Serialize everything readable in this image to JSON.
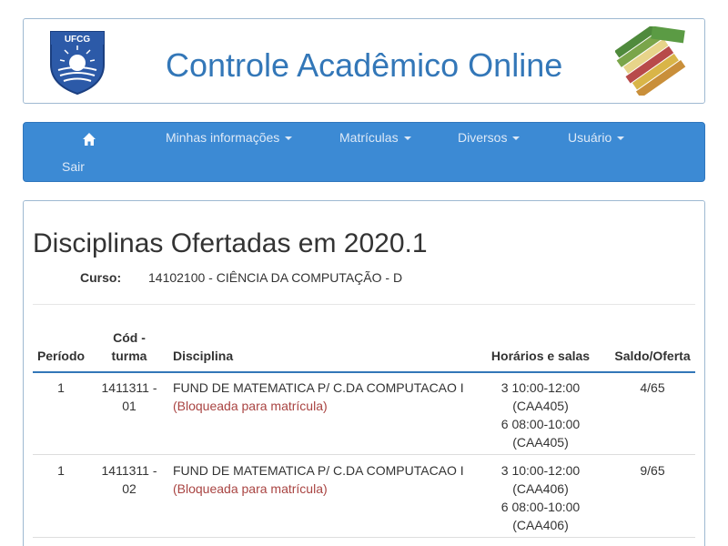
{
  "header": {
    "title": "Controle Acadêmico Online",
    "logo_text": "UFCG"
  },
  "nav": {
    "items": [
      {
        "label": "Minhas informações"
      },
      {
        "label": "Matrículas"
      },
      {
        "label": "Diversos"
      },
      {
        "label": "Usuário"
      }
    ],
    "sair": "Sair",
    "home_icon": "home-icon"
  },
  "page": {
    "title": "Disciplinas Ofertadas em 2020.1",
    "curso_label": "Curso:",
    "curso_value": "14102100 - CIÊNCIA DA COMPUTAÇÃO - D"
  },
  "table": {
    "headers": {
      "periodo": "Período",
      "cod_turma_1": "Cód -",
      "cod_turma_2": "turma",
      "disciplina": "Disciplina",
      "horarios": "Horários e salas",
      "saldo": "Saldo/Oferta"
    },
    "rows": [
      {
        "periodo": "1",
        "cod_1": "1411311 -",
        "cod_2": "01",
        "disciplina": "FUND DE MATEMATICA P/ C.DA COMPUTACAO I",
        "status": "(Bloqueada para matrícula)",
        "horario_1": "3 10:00-12:00",
        "sala_1": "(CAA405)",
        "horario_2": "6 08:00-10:00",
        "sala_2": "(CAA405)",
        "saldo": "4/65"
      },
      {
        "periodo": "1",
        "cod_1": "1411311 -",
        "cod_2": "02",
        "disciplina": "FUND DE MATEMATICA P/ C.DA COMPUTACAO I",
        "status": "(Bloqueada para matrícula)",
        "horario_1": "3 10:00-12:00",
        "sala_1": "(CAA406)",
        "horario_2": "6 08:00-10:00",
        "sala_2": "(CAA406)",
        "saldo": "9/65"
      }
    ]
  }
}
